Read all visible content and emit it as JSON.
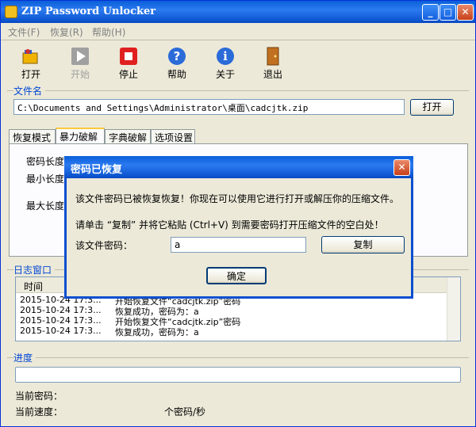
{
  "window": {
    "title": "ZIP Password Unlocker"
  },
  "menu": [
    {
      "label": "文件(F)"
    },
    {
      "label": "恢复(R)"
    },
    {
      "label": "帮助(H)"
    }
  ],
  "toolbar": {
    "open": "打开",
    "start": "开始",
    "stop": "停止",
    "help": "帮助",
    "about": "关于",
    "exit": "退出"
  },
  "file_section": {
    "label": "文件名",
    "path": "C:\\Documents and Settings\\Administrator\\桌面\\cadcjtk.zip",
    "open_button": "打开"
  },
  "tabs": [
    "恢复模式",
    "暴力破解",
    "字典破解",
    "选项设置"
  ],
  "brute_force": {
    "length_label": "密码长度",
    "min_label": "最小长度",
    "max_label": "最大长度"
  },
  "log": {
    "label": "日志窗口",
    "column_time": "时间",
    "rows": [
      {
        "time": "2015-10-24 17:3...",
        "msg": "开始恢复文件“cadcjtk.zip”密码"
      },
      {
        "time": "2015-10-24 17:3...",
        "msg": "恢复成功，密码为：a"
      },
      {
        "time": "2015-10-24 17:3...",
        "msg": "开始恢复文件“cadcjtk.zip”密码"
      },
      {
        "time": "2015-10-24 17:3...",
        "msg": "恢复成功，密码为：a"
      }
    ]
  },
  "progress": {
    "label": "进度",
    "current_password_label": "当前密码：",
    "current_speed_label": "当前速度：",
    "speed_unit": "个密码/秒"
  },
  "dialog": {
    "title": "密码已恢复",
    "message1": "该文件密码已被恢复恢复！你现在可以使用它进行打开或解压你的压缩文件。",
    "message2": "请单击 “复制” 并将它粘贴 (Ctrl+V) 到需要密码打开压缩文件的空白处！",
    "password_label": "该文件密码：",
    "password_value": "a",
    "copy_button": "复制",
    "ok_button": "确定"
  },
  "colors": {
    "title_bar": "#0a5fd8",
    "group_label": "#0046d5",
    "close": "#c8401a"
  }
}
